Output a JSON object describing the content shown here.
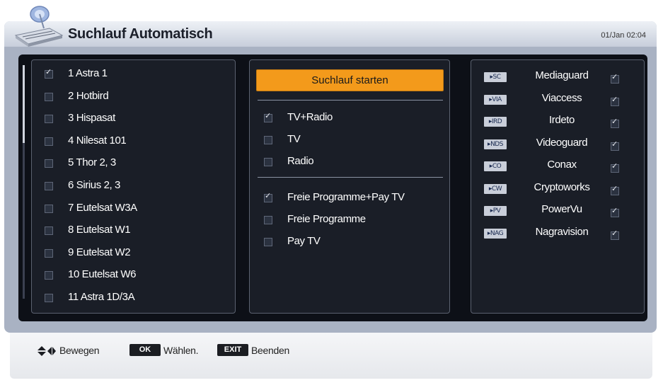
{
  "header": {
    "title": "Suchlauf Automatisch",
    "clock": "01/Jan 02:04"
  },
  "satellites": [
    {
      "label": "1 Astra 1",
      "checked": true
    },
    {
      "label": "2 Hotbird",
      "checked": false
    },
    {
      "label": "3 Hispasat",
      "checked": false
    },
    {
      "label": "4 Nilesat 101",
      "checked": false
    },
    {
      "label": "5 Thor 2, 3",
      "checked": false
    },
    {
      "label": "6 Sirius 2, 3",
      "checked": false
    },
    {
      "label": "7 Eutelsat W3A",
      "checked": false
    },
    {
      "label": "8 Eutelsat W1",
      "checked": false
    },
    {
      "label": "9 Eutelsat W2",
      "checked": false
    },
    {
      "label": "10 Eutelsat W6",
      "checked": false
    },
    {
      "label": "11 Astra 1D/3A",
      "checked": false
    }
  ],
  "options": {
    "start_label": "Suchlauf starten",
    "service_types": [
      {
        "label": "TV+Radio",
        "checked": true
      },
      {
        "label": "TV",
        "checked": false
      },
      {
        "label": "Radio",
        "checked": false
      }
    ],
    "program_types": [
      {
        "label": "Freie Programme+Pay TV",
        "checked": true
      },
      {
        "label": "Freie Programme",
        "checked": false
      },
      {
        "label": "Pay TV",
        "checked": false
      }
    ]
  },
  "ca_systems": [
    {
      "badge": "SC",
      "name": "Mediaguard",
      "checked": true
    },
    {
      "badge": "VIA",
      "name": "Viaccess",
      "checked": true
    },
    {
      "badge": "IRD",
      "name": "Irdeto",
      "checked": true
    },
    {
      "badge": "NDS",
      "name": "Videoguard",
      "checked": true
    },
    {
      "badge": "CO",
      "name": "Conax",
      "checked": true
    },
    {
      "badge": "CW",
      "name": "Cryptoworks",
      "checked": true
    },
    {
      "badge": "PV",
      "name": "PowerVu",
      "checked": true
    },
    {
      "badge": "NAG",
      "name": "Nagravision",
      "checked": true
    }
  ],
  "footer": {
    "move_label": "Bewegen",
    "ok_key": "OK",
    "select_label": "Wählen.",
    "exit_key": "EXIT",
    "exit_label": "Beenden"
  },
  "colors": {
    "accent": "#f39a1b",
    "panel": "#1a1e27",
    "frame": "#a9b2c3"
  }
}
